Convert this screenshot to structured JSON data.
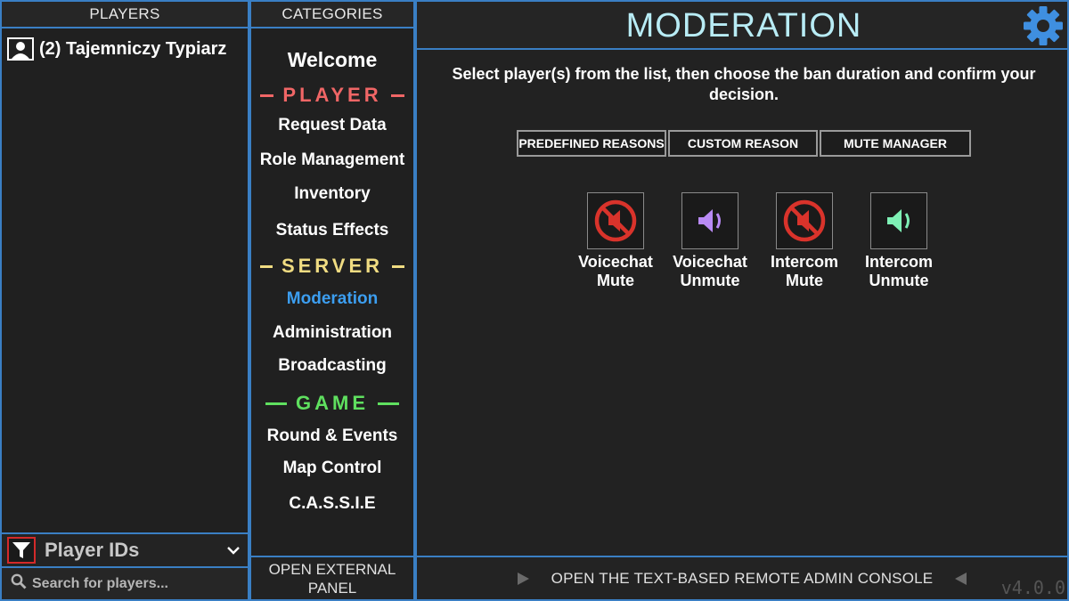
{
  "players_panel": {
    "header": "PLAYERS",
    "players": [
      {
        "label": "(2) Tajemniczy Typiarz"
      }
    ],
    "filter": {
      "label": "Player IDs",
      "icon": "filter-icon"
    },
    "search": {
      "placeholder": "Search for players..."
    }
  },
  "categories_panel": {
    "header": "CATEGORIES",
    "welcome": "Welcome",
    "sections": {
      "player": {
        "title": "PLAYER",
        "color": "#f06666"
      },
      "server": {
        "title": "SERVER",
        "color": "#f0dc82"
      },
      "game": {
        "title": "GAME",
        "color": "#5fe05f"
      }
    },
    "player_items": [
      "Request Data",
      "Role Management",
      "Inventory",
      "Status Effects"
    ],
    "server_items": [
      "Moderation",
      "Administration",
      "Broadcasting"
    ],
    "game_items": [
      "Round & Events",
      "Map Control",
      "C.A.S.S.I.E"
    ],
    "active_item": "Moderation",
    "open_external": "OPEN EXTERNAL PANEL"
  },
  "main": {
    "title": "MODERATION",
    "instructions": "Select player(s) from the list, then choose the ban duration and confirm your decision.",
    "tabs": [
      "PREDEFINED REASONS",
      "CUSTOM REASON",
      "MUTE MANAGER"
    ],
    "actions": [
      {
        "label_1": "Voicechat",
        "label_2": "Mute",
        "icon": "muted-speaker-icon"
      },
      {
        "label_1": "Voicechat",
        "label_2": "Unmute",
        "icon": "speaker-icon",
        "color": "#b98af5"
      },
      {
        "label_1": "Intercom",
        "label_2": "Mute",
        "icon": "muted-speaker-icon"
      },
      {
        "label_1": "Intercom",
        "label_2": "Unmute",
        "icon": "speaker-icon",
        "color": "#7ef0b5"
      }
    ],
    "console_button": "OPEN THE TEXT-BASED REMOTE ADMIN CONSOLE",
    "version": "v4.0.0"
  },
  "colors": {
    "border": "#3a7fc4",
    "active": "#3c9ef0",
    "mute_red": "#d9332b",
    "title": "#b8ecf5",
    "gear": "#3f8fe0"
  }
}
